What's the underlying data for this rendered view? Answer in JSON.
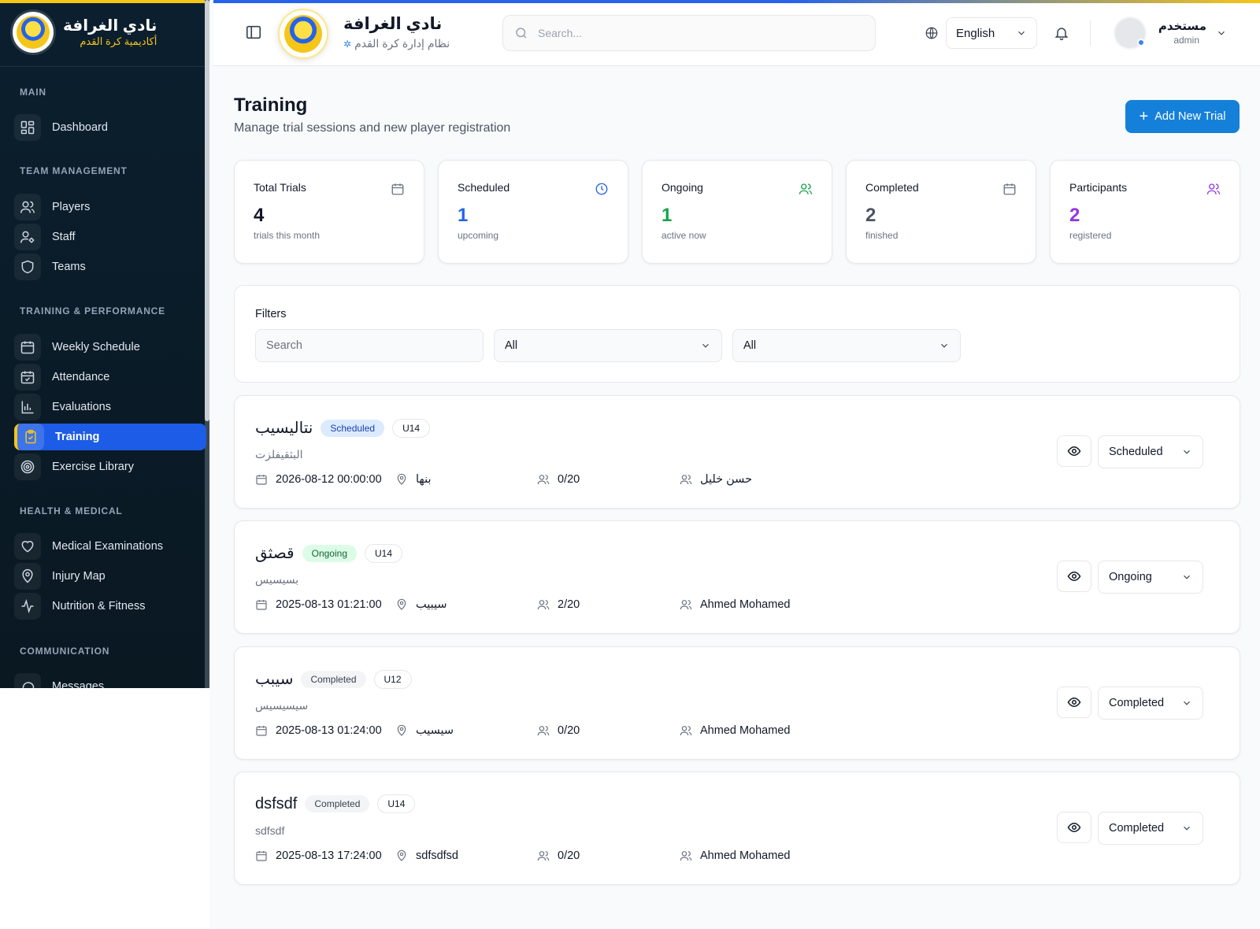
{
  "brand": {
    "title": "نادي الغرافة",
    "subtitle": "أكاديمية كرة القدم"
  },
  "sidebar": {
    "sections": [
      {
        "label": "MAIN"
      },
      {
        "label": "TEAM MANAGEMENT"
      },
      {
        "label": "TRAINING & PERFORMANCE"
      },
      {
        "label": "HEALTH & MEDICAL"
      },
      {
        "label": "COMMUNICATION"
      }
    ],
    "items": [
      {
        "label": "Dashboard",
        "icon": "dashboard-icon"
      },
      {
        "label": "Players",
        "icon": "users-icon"
      },
      {
        "label": "Staff",
        "icon": "user-cog-icon"
      },
      {
        "label": "Teams",
        "icon": "shield-icon"
      },
      {
        "label": "Weekly Schedule",
        "icon": "calendar-icon"
      },
      {
        "label": "Attendance",
        "icon": "calendar-check-icon"
      },
      {
        "label": "Evaluations",
        "icon": "bar-chart-icon"
      },
      {
        "label": "Training",
        "icon": "clipboard-icon",
        "active": true
      },
      {
        "label": "Exercise Library",
        "icon": "target-icon"
      },
      {
        "label": "Medical Examinations",
        "icon": "heart-icon"
      },
      {
        "label": "Injury Map",
        "icon": "map-pin-icon"
      },
      {
        "label": "Nutrition & Fitness",
        "icon": "activity-icon"
      },
      {
        "label": "Messages",
        "icon": "message-icon"
      }
    ]
  },
  "header": {
    "title": "نادي الغرافة",
    "subtitle": "نظام إدارة كرة القدم",
    "search_placeholder": "Search...",
    "language": "English",
    "user_name": "مستخدم",
    "user_role": "admin"
  },
  "page": {
    "title": "Training",
    "subtitle": "Manage trial sessions and new player registration",
    "add_button": "Add New Trial"
  },
  "stats": [
    {
      "label": "Total Trials",
      "value": "4",
      "note": "trials this month",
      "color": "#111827",
      "icon": "calendar-icon",
      "icon_color": "#6b7280"
    },
    {
      "label": "Scheduled",
      "value": "1",
      "note": "upcoming",
      "color": "#2563eb",
      "icon": "clock-icon",
      "icon_color": "#2563eb"
    },
    {
      "label": "Ongoing",
      "value": "1",
      "note": "active now",
      "color": "#16a34a",
      "icon": "users-icon",
      "icon_color": "#16a34a"
    },
    {
      "label": "Completed",
      "value": "2",
      "note": "finished",
      "color": "#4b5563",
      "icon": "calendar-icon",
      "icon_color": "#6b7280"
    },
    {
      "label": "Participants",
      "value": "2",
      "note": "registered",
      "color": "#9333ea",
      "icon": "users-icon",
      "icon_color": "#9333ea"
    }
  ],
  "filters": {
    "title": "Filters",
    "search_placeholder": "Search",
    "status_value": "All",
    "age_value": "All"
  },
  "trials": [
    {
      "name": "نتاليسيب",
      "status": "Scheduled",
      "status_class": "scheduled",
      "age": "U14",
      "description": "البثقيفلزت",
      "datetime": "2026-08-12 00:00:00",
      "location": "بنها",
      "participants": "0/20",
      "coach": "حسن خليل",
      "select": "Scheduled"
    },
    {
      "name": "قصثق",
      "status": "Ongoing",
      "status_class": "ongoing",
      "age": "U14",
      "description": "بسيسيس",
      "datetime": "2025-08-13 01:21:00",
      "location": "سيبيب",
      "participants": "2/20",
      "coach": "Ahmed Mohamed",
      "select": "Ongoing"
    },
    {
      "name": "سيبب",
      "status": "Completed",
      "status_class": "completed",
      "age": "U12",
      "description": "سيسيسيس",
      "datetime": "2025-08-13 01:24:00",
      "location": "سيسيب",
      "participants": "0/20",
      "coach": "Ahmed Mohamed",
      "select": "Completed"
    },
    {
      "name": "dsfsdf",
      "status": "Completed",
      "status_class": "completed",
      "age": "U14",
      "description": "sdfsdf",
      "datetime": "2025-08-13 17:24:00",
      "location": "sdfsdfsd",
      "participants": "0/20",
      "coach": "Ahmed Mohamed",
      "select": "Completed"
    }
  ],
  "colors": {
    "accent": "#1d5ce6",
    "brand_yellow": "#f5c518",
    "primary_button": "#1580d9"
  }
}
